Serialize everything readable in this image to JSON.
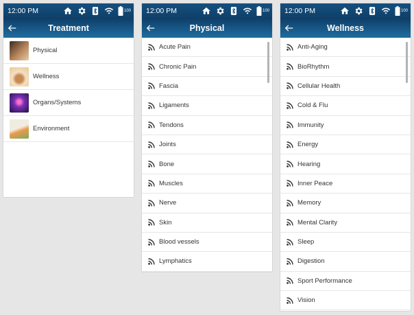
{
  "status": {
    "time": "12:00 PM",
    "battery": "100"
  },
  "screens": {
    "treatment": {
      "title": "Treatment",
      "items": [
        {
          "label": "Physical",
          "thumb": "physical-thumb",
          "colors": [
            "#6b4a3a",
            "#c9a27a"
          ]
        },
        {
          "label": "Wellness",
          "thumb": "wellness-thumb",
          "colors": [
            "#f0d8b8",
            "#d6aa6c"
          ]
        },
        {
          "label": "Organs/Systems",
          "thumb": "organs-thumb",
          "colors": [
            "#4a1e7a",
            "#c33fa5"
          ]
        },
        {
          "label": "Environment",
          "thumb": "environment-thumb",
          "colors": [
            "#e7e0cf",
            "#e38a3b"
          ]
        }
      ]
    },
    "physical": {
      "title": "Physical",
      "items": [
        "Acute Pain",
        "Chronic Pain",
        "Fascia",
        "Ligaments",
        "Tendons",
        "Joints",
        "Bone",
        "Muscles",
        "Nerve",
        "Skin",
        "Blood vessels",
        "Lymphatics"
      ]
    },
    "wellness": {
      "title": "Wellness",
      "items": [
        "Anti-Aging",
        "BioRhythm",
        "Cellular Health",
        "Cold & Flu",
        "Immunity",
        "Energy",
        "Hearing",
        "Inner Peace",
        "Memory",
        "Mental Clarity",
        "Sleep",
        "Digestion",
        "Sport Performance",
        "Vision"
      ]
    }
  },
  "colors": {
    "header_top": "#15507f",
    "header_bottom": "#1f6da0",
    "divider": "#e6e6e6",
    "text": "#333333"
  },
  "icons": {
    "status": [
      "home-icon",
      "gear-icon",
      "bluetooth-icon",
      "wifi-icon",
      "battery-icon"
    ],
    "back": "back-arrow-icon",
    "list": "rss-icon"
  }
}
